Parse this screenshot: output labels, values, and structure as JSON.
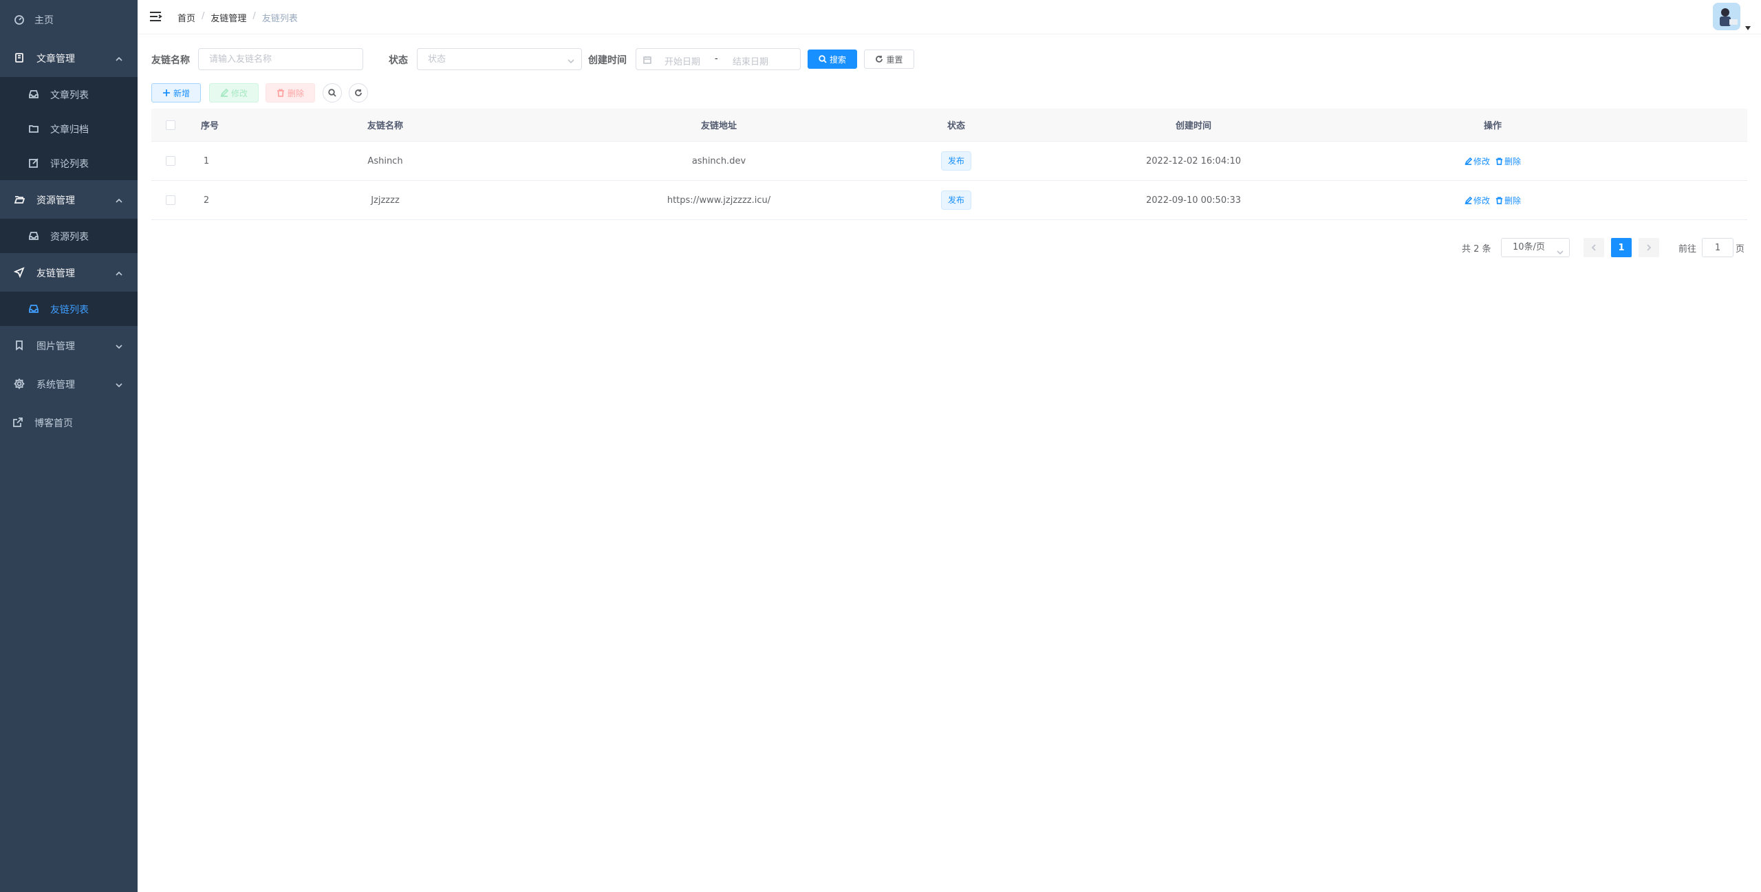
{
  "sidebar": {
    "home": "主页",
    "article_mgmt": "文章管理",
    "article_list": "文章列表",
    "article_archive": "文章归档",
    "comment_list": "评论列表",
    "resource_mgmt": "资源管理",
    "resource_list": "资源列表",
    "friendlink_mgmt": "友链管理",
    "friendlink_list": "友链列表",
    "image_mgmt": "图片管理",
    "system_mgmt": "系统管理",
    "blog_home": "博客首页"
  },
  "navbar": {
    "breadcrumb": [
      "首页",
      "友链管理",
      "友链列表"
    ],
    "separator": "/"
  },
  "search": {
    "name_label": "友链名称",
    "name_placeholder": "请输入友链名称",
    "status_label": "状态",
    "status_placeholder": "状态",
    "created_label": "创建时间",
    "start_placeholder": "开始日期",
    "date_sep": "-",
    "end_placeholder": "结束日期",
    "search_btn": "搜索",
    "reset_btn": "重置"
  },
  "toolbar": {
    "add": "新增",
    "edit": "修改",
    "delete": "删除"
  },
  "table": {
    "headers": [
      "序号",
      "友链名称",
      "友链地址",
      "状态",
      "创建时间",
      "操作"
    ],
    "rows": [
      {
        "index": "1",
        "name": "Ashinch",
        "url": "ashinch.dev",
        "status": "发布",
        "created": "2022-12-02 16:04:10"
      },
      {
        "index": "2",
        "name": "Jzjzzzz",
        "url": "https://www.jzjzzzz.icu/",
        "status": "发布",
        "created": "2022-09-10 00:50:33"
      }
    ],
    "op_edit": "修改",
    "op_delete": "删除"
  },
  "pagination": {
    "total": "共 2 条",
    "page_size": "10条/页",
    "current": "1",
    "goto_prefix": "前往",
    "goto_value": "1",
    "goto_suffix": "页"
  },
  "colors": {
    "sidebar_bg": "#304156",
    "submenu_bg": "#1f2d3d",
    "primary": "#1890ff"
  }
}
